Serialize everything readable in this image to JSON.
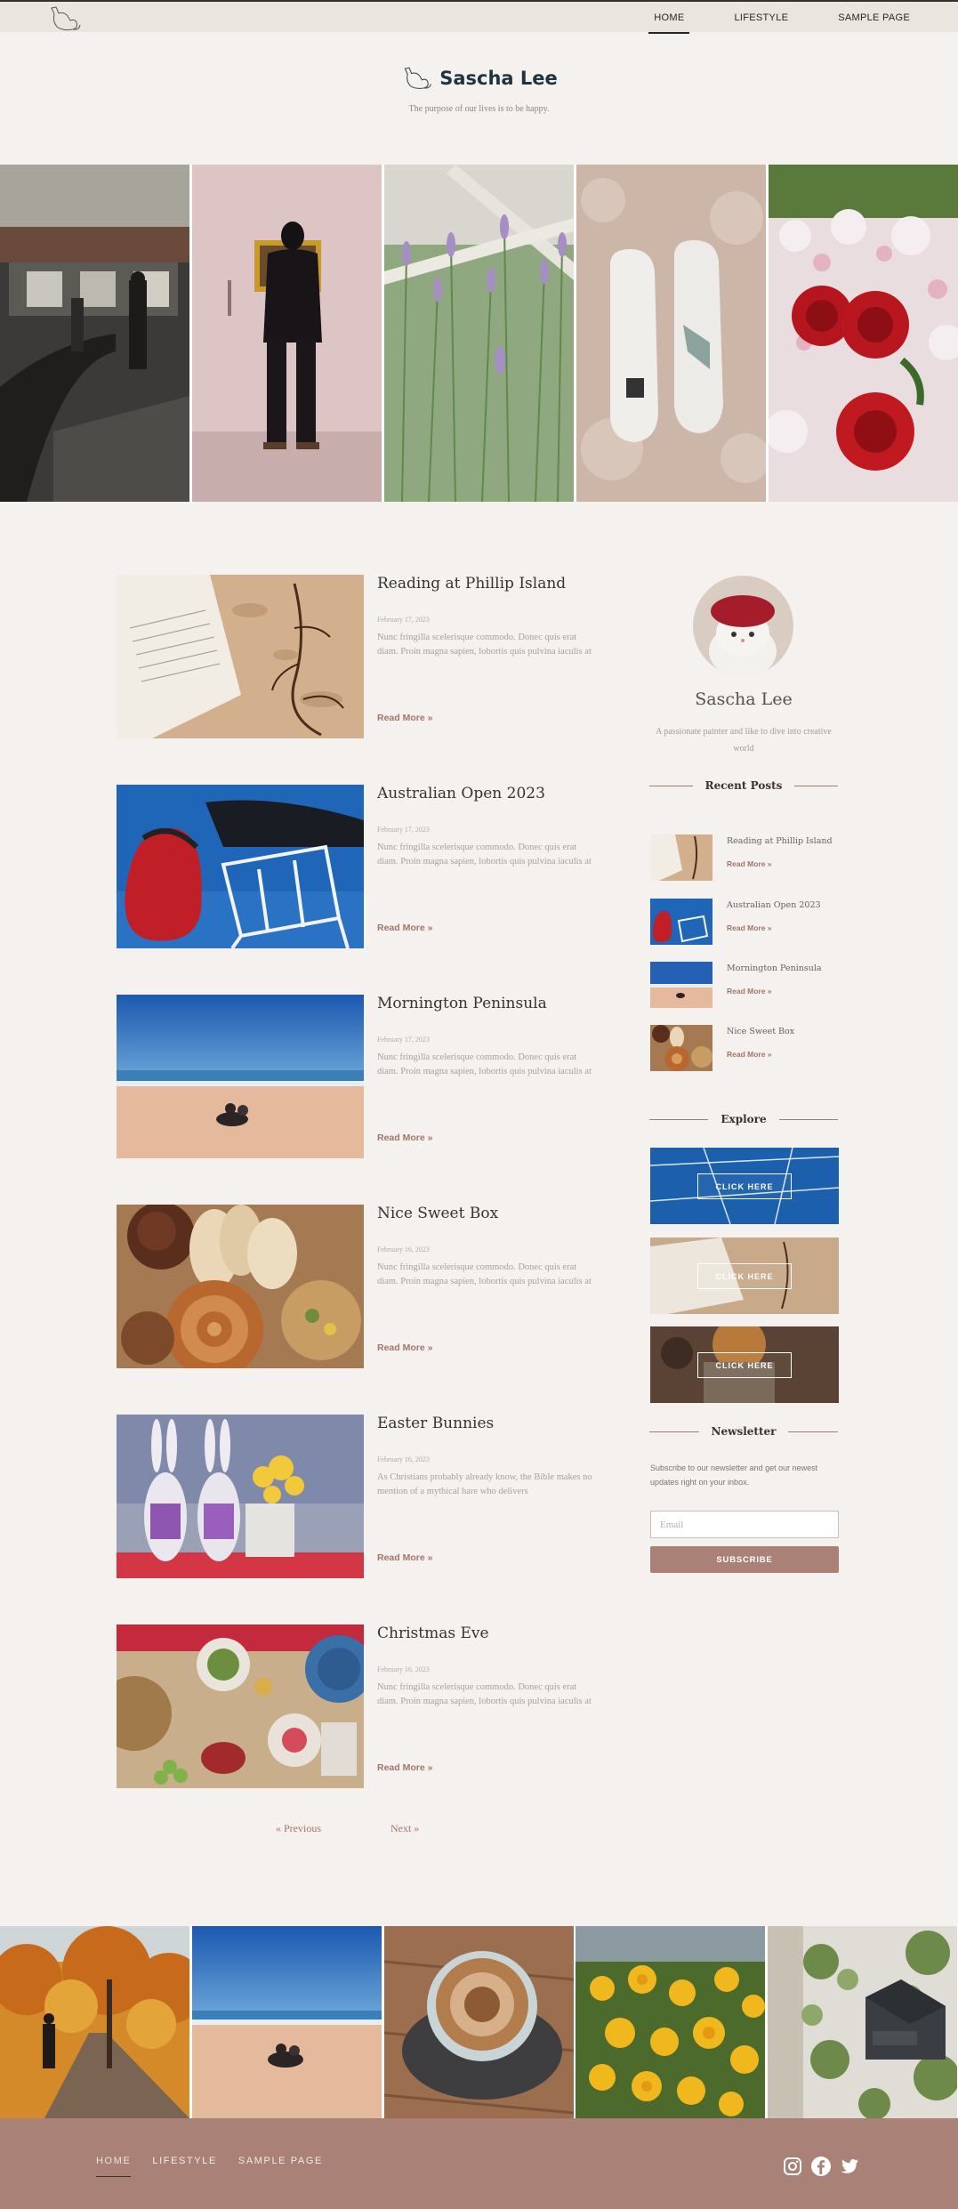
{
  "nav": {
    "items": [
      "HOME",
      "LIFESTYLE",
      "SAMPLE PAGE"
    ],
    "active": 0
  },
  "brand": {
    "name": "Sascha Lee",
    "tagline": "The purpose of our lives is to be happy."
  },
  "hero": {
    "photos": [
      "cafe-interior",
      "man-viewing-painting",
      "lavender-field",
      "sneakers-on-rug",
      "roses-bouquet"
    ]
  },
  "posts": [
    {
      "title": "Reading at Phillip Island",
      "date": "February 17, 2023",
      "excerpt": "Nunc fringilla scelerisque commodo. Donec quis erat diam. Proin magna sapien, lobortis quis pulvina iaculis at",
      "readmore": "Read More »"
    },
    {
      "title": "Australian Open 2023",
      "date": "February 17, 2023",
      "excerpt": "Nunc fringilla scelerisque commodo. Donec quis erat diam. Proin magna sapien, lobortis quis pulvina iaculis at",
      "readmore": "Read More »"
    },
    {
      "title": "Mornington Peninsula",
      "date": "February 17, 2023",
      "excerpt": "Nunc fringilla scelerisque commodo. Donec quis erat diam. Proin magna sapien, lobortis quis pulvina iaculis at",
      "readmore": "Read More »"
    },
    {
      "title": "Nice Sweet Box",
      "date": "February 16, 2023",
      "excerpt": "Nunc fringilla scelerisque commodo. Donec quis erat diam. Proin magna sapien, lobortis quis pulvina iaculis at",
      "readmore": "Read More »"
    },
    {
      "title": "Easter Bunnies",
      "date": "February 16, 2023",
      "excerpt": "As Christians probably already know, the Bible makes no mention of a mythical hare who delivers",
      "readmore": "Read More »"
    },
    {
      "title": "Christmas Eve",
      "date": "February 16, 2023",
      "excerpt": "Nunc fringilla scelerisque commodo. Donec quis erat diam. Proin magna sapien, lobortis quis pulvina iaculis at",
      "readmore": "Read More »"
    }
  ],
  "pagination": {
    "prev": "« Previous",
    "next": "Next »"
  },
  "sidebar": {
    "name": "Sascha Lee",
    "bio": "A passionate painter and like to dive into creative world",
    "recent_heading": "Recent Posts",
    "recent": [
      {
        "title": "Reading at Phillip Island",
        "readmore": "Read More »"
      },
      {
        "title": "Australian Open 2023",
        "readmore": "Read More »"
      },
      {
        "title": "Mornington Peninsula",
        "readmore": "Read More »"
      },
      {
        "title": "Nice Sweet Box",
        "readmore": "Read More »"
      }
    ],
    "explore_heading": "Explore",
    "explore_buttons": [
      "CLICK HERE",
      "CLICK HERE",
      "CLICK HERE"
    ],
    "newsletter_heading": "Newsletter",
    "newsletter_text": "Subscribe to our newsletter and get our newest updates right on your inbox.",
    "email_placeholder": "Email",
    "subscribe_label": "SUBSCRIBE"
  },
  "footer": {
    "nav": [
      "HOME",
      "LIFESTYLE",
      "SAMPLE PAGE"
    ],
    "social": [
      "instagram-icon",
      "facebook-icon",
      "twitter-icon"
    ]
  },
  "colors": {
    "background": "#f4f1ee",
    "accent": "#a98176",
    "brand_text": "#1f3442",
    "link": "#a17668"
  }
}
